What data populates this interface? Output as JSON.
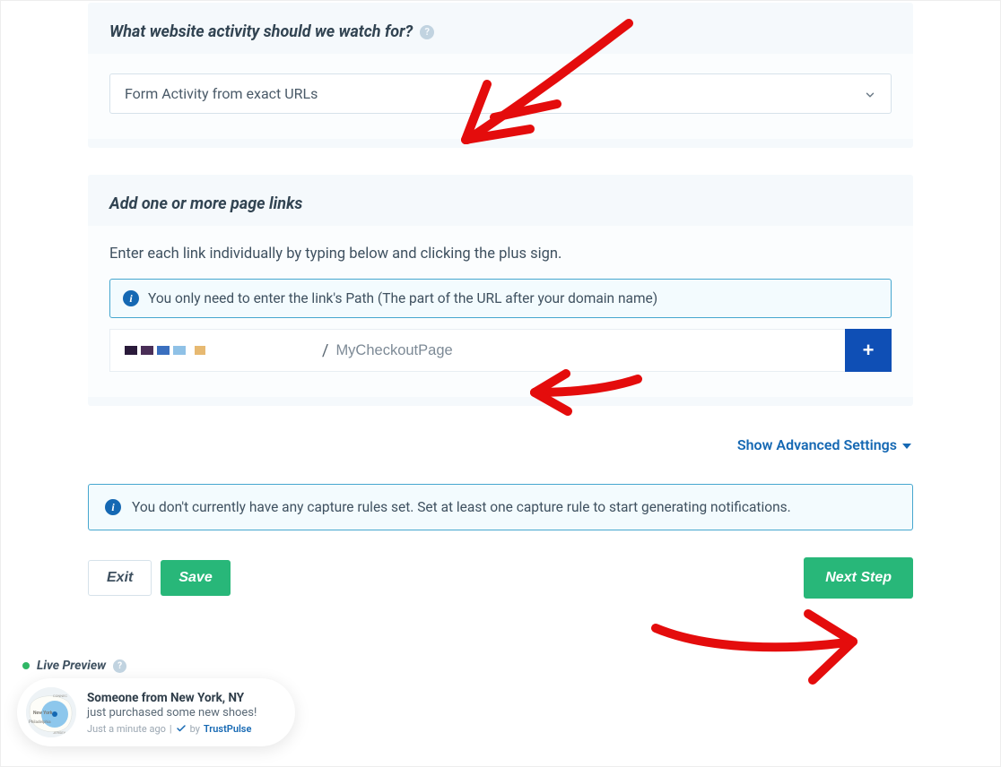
{
  "panel1": {
    "title": "What website activity should we watch for?",
    "select_value": "Form Activity from exact URLs"
  },
  "panel2": {
    "title": "Add one or more page links",
    "hint": "Enter each link individually by typing below and clicking the plus sign.",
    "info": "You only need to enter the link's Path (The part of the URL after your domain name)",
    "slash": "/",
    "placeholder": "MyCheckoutPage"
  },
  "advanced": {
    "label": "Show Advanced Settings"
  },
  "warning": "You don't currently have any capture rules set. Set at least one capture rule to start generating notifications.",
  "buttons": {
    "exit": "Exit",
    "save": "Save",
    "next": "Next Step"
  },
  "preview": {
    "label": "Live Preview",
    "title": "Someone from New York, NY",
    "subtitle": "just purchased some new shoes!",
    "time": "Just a minute ago",
    "by": "by",
    "brand": "TrustPulse"
  }
}
